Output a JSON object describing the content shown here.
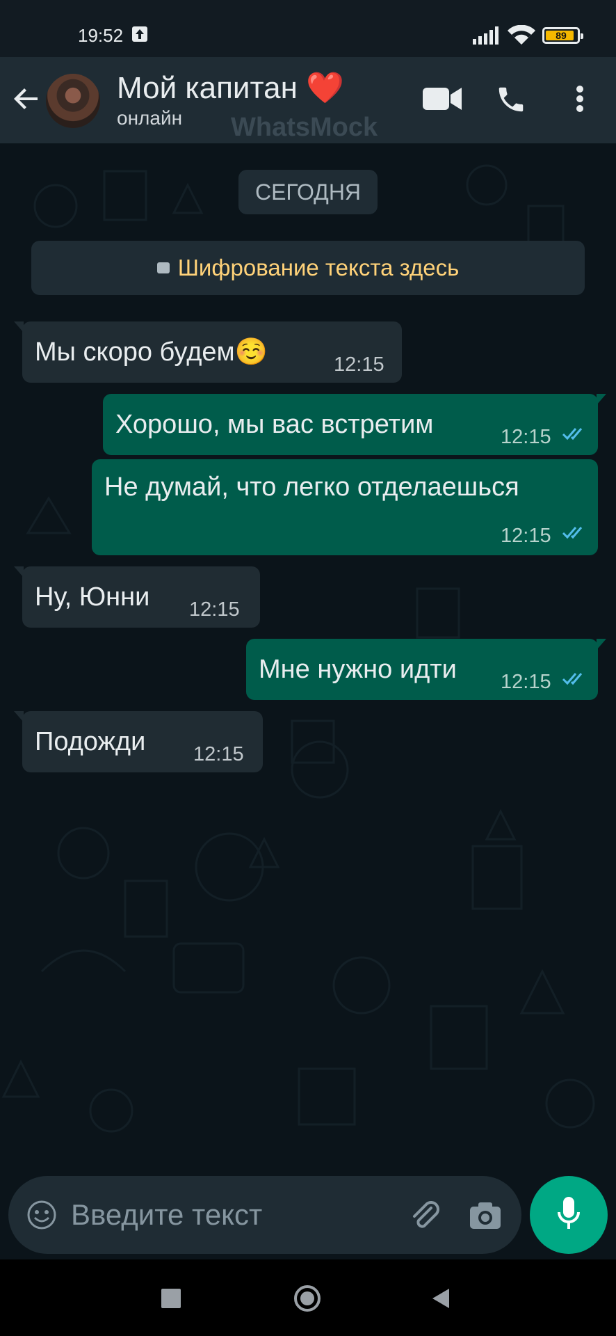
{
  "status_bar": {
    "time": "19:52",
    "battery_level": "89",
    "battery_fraction": 0.89,
    "icons": [
      "upload-icon",
      "signal-icon",
      "wifi-icon",
      "battery-icon"
    ]
  },
  "header": {
    "contact_name": "Мой капитан",
    "name_emoji": "❤️",
    "status": "онлайн",
    "watermark": "WhatsMock",
    "icons": [
      "back-arrow-icon",
      "avatar",
      "video-call-icon",
      "phone-call-icon",
      "more-vert-icon"
    ]
  },
  "chat": {
    "date_chip": "СЕГОДНЯ",
    "encryption_notice": "Шифрование текста здесь",
    "messages": [
      {
        "direction": "in",
        "text": "Мы скоро будем☺️",
        "time": "12:15"
      },
      {
        "direction": "out",
        "text": "Хорошо, мы вас встретим",
        "time": "12:15",
        "status": "read"
      },
      {
        "direction": "out",
        "text": "Не думай, что легко отделаешься",
        "time": "12:15",
        "status": "read"
      },
      {
        "direction": "in",
        "text": "Ну, Юнни",
        "time": "12:15"
      },
      {
        "direction": "out",
        "text": "Мне нужно идти",
        "time": "12:15",
        "status": "read"
      },
      {
        "direction": "in",
        "text": "Подожди",
        "time": "12:15"
      }
    ]
  },
  "input_bar": {
    "placeholder": "Введите текст",
    "icons": [
      "emoji-icon",
      "attach-icon",
      "camera-icon",
      "mic-icon"
    ]
  },
  "colors": {
    "background": "#0b141a",
    "header": "#1f2c34",
    "incoming_bubble": "#202c33",
    "outgoing_bubble": "#005c4b",
    "accent": "#00a884",
    "read_ticks": "#53bdeb",
    "encryption_text": "#ffd279"
  }
}
